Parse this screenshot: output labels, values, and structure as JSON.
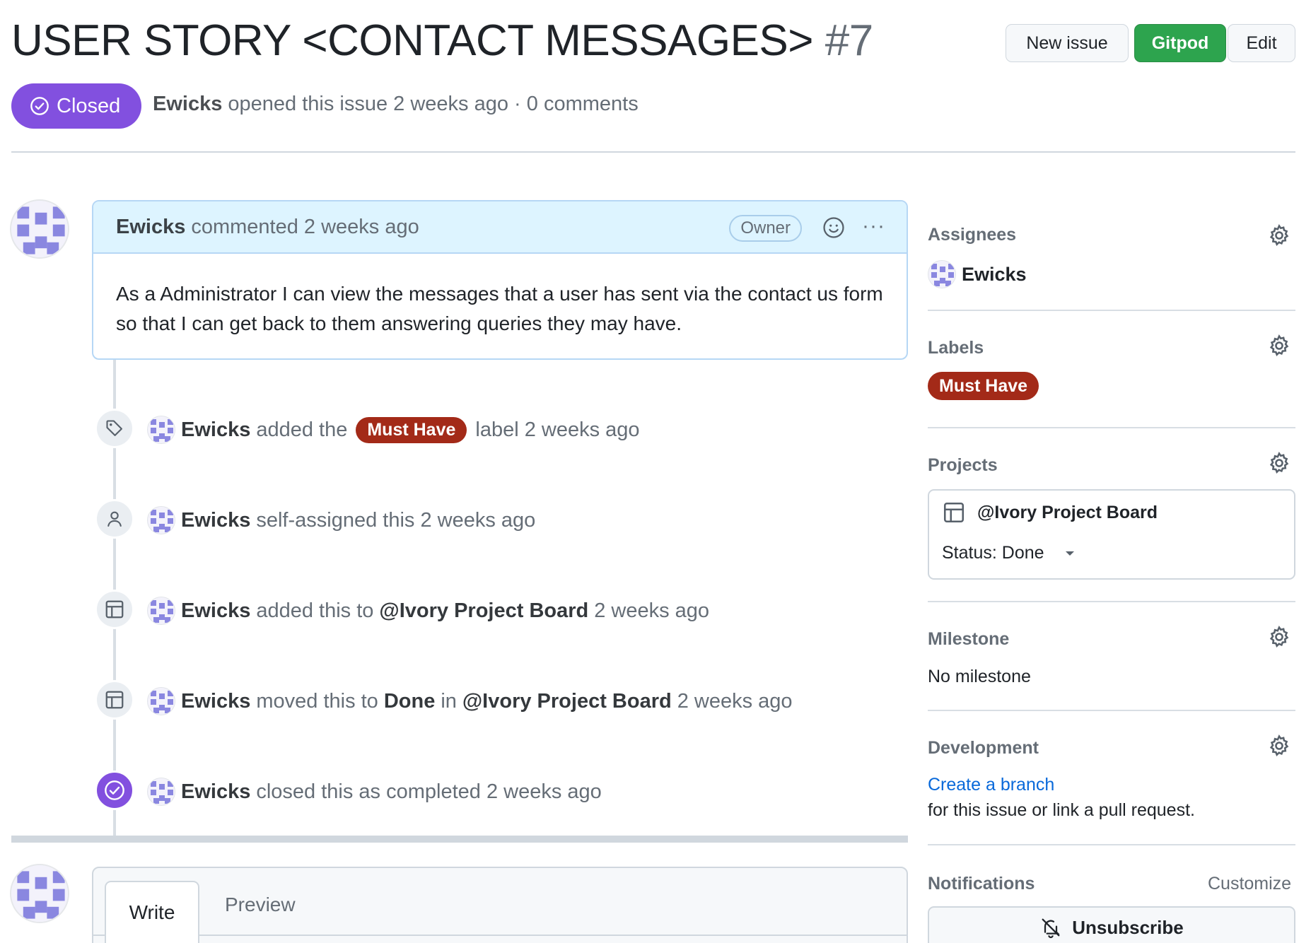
{
  "issue": {
    "title": "USER STORY <CONTACT MESSAGES>",
    "number": "#7",
    "state": "Closed",
    "author": "Ewicks",
    "meta_text": "opened this issue 2 weeks ago · 0 comments"
  },
  "header_buttons": {
    "new_issue": "New issue",
    "gitpod": "Gitpod",
    "edit": "Edit"
  },
  "comment": {
    "author": "Ewicks",
    "action": "commented 2 weeks ago",
    "badge": "Owner",
    "more": "···",
    "body": "As a Administrator I can view the messages that a user has sent via the contact us form so that I can get back to them answering queries they may have."
  },
  "timeline": [
    {
      "icon": "tag-icon",
      "actor": "Ewicks",
      "pre": "added the",
      "label": "Must Have",
      "post": "label 2 weeks ago"
    },
    {
      "icon": "person-icon",
      "actor": "Ewicks",
      "text": "self-assigned this 2 weeks ago"
    },
    {
      "icon": "project-table-icon",
      "actor": "Ewicks",
      "pre": "added this to",
      "project": "@Ivory Project Board",
      "post": "2 weeks ago"
    },
    {
      "icon": "project-table-icon",
      "actor": "Ewicks",
      "pre": "moved this to",
      "column": "Done",
      "mid": "in",
      "project": "@Ivory Project Board",
      "post": "2 weeks ago"
    },
    {
      "icon": "check-circle-icon",
      "actor": "Ewicks",
      "text": "closed this as completed 2 weeks ago"
    }
  ],
  "editor": {
    "tabs": [
      "Write",
      "Preview"
    ]
  },
  "sidebar": {
    "assignees": {
      "heading": "Assignees",
      "user": "Ewicks"
    },
    "labels": {
      "heading": "Labels",
      "items": [
        "Must Have"
      ]
    },
    "projects": {
      "heading": "Projects",
      "board": "@Ivory Project Board",
      "status": "Status: Done"
    },
    "milestone": {
      "heading": "Milestone",
      "value": "No milestone"
    },
    "development": {
      "heading": "Development",
      "link": "Create a branch",
      "text": "for this issue or link a pull request."
    },
    "notifications": {
      "heading": "Notifications",
      "customize": "Customize",
      "button": "Unsubscribe"
    }
  },
  "colors": {
    "closed_purple": "#8250df",
    "label_red": "#a32a18",
    "gitpod_green": "#2da44e",
    "link_blue": "#0969da"
  }
}
